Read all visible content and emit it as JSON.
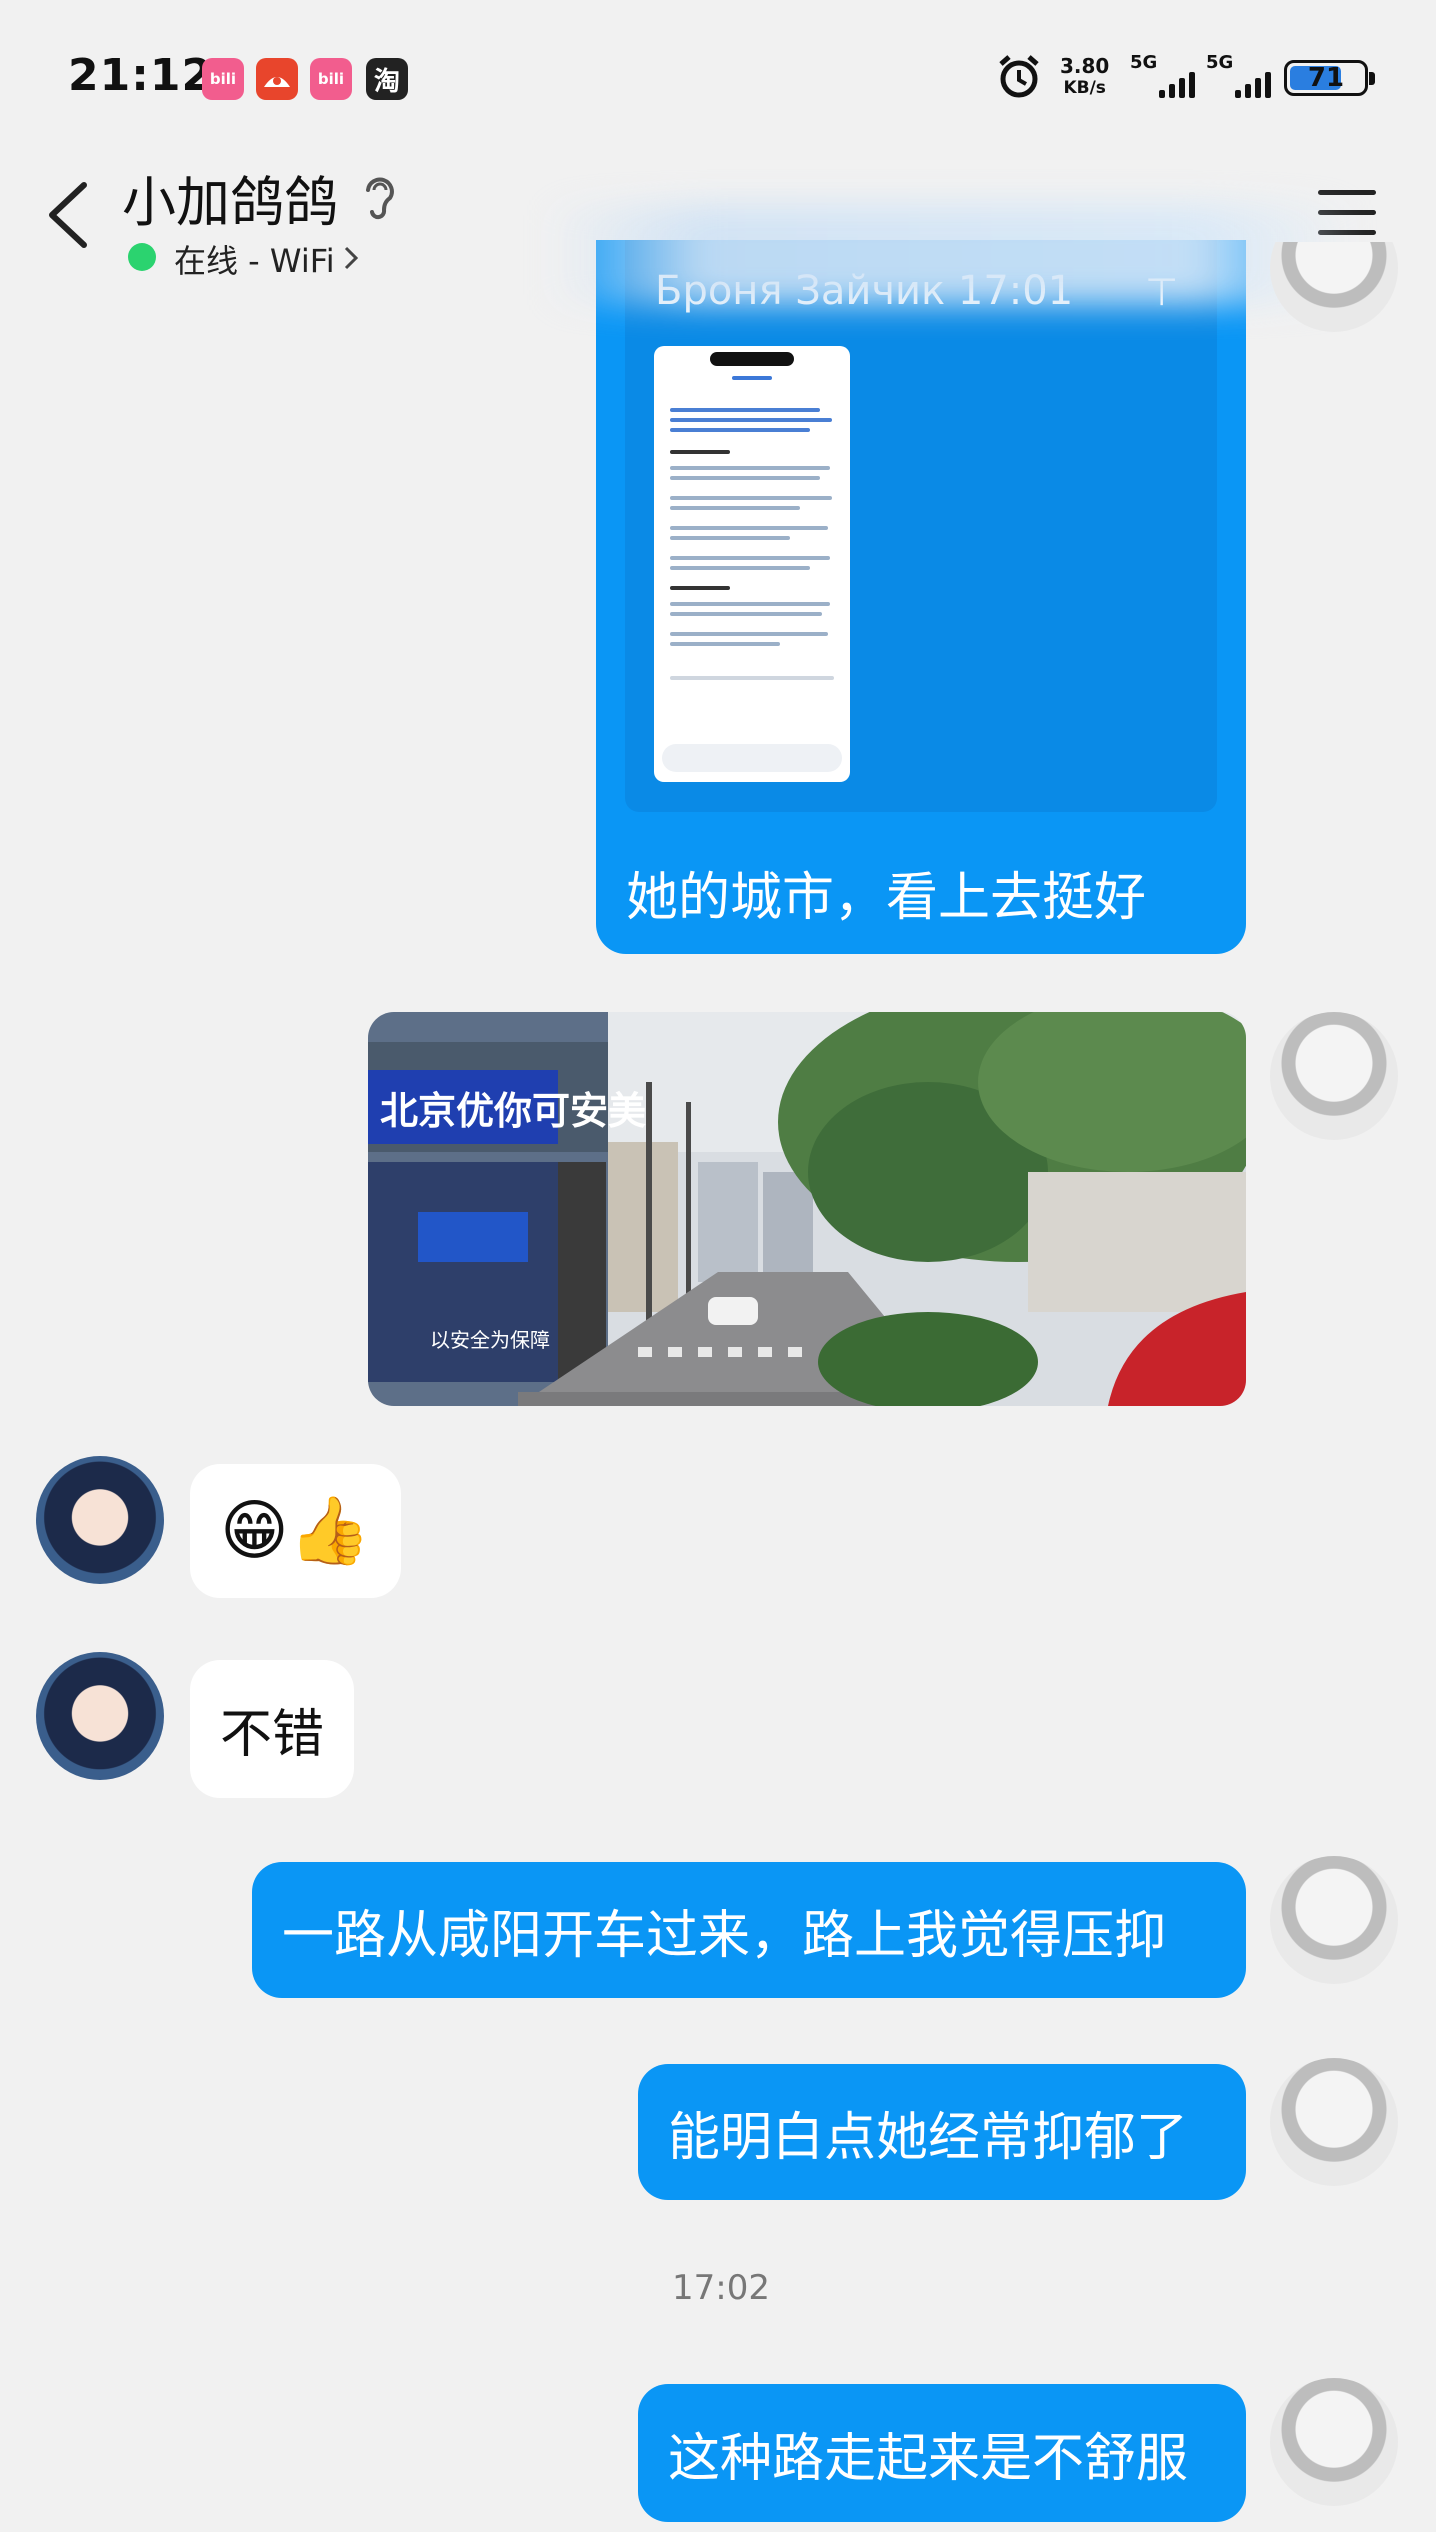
{
  "status_bar": {
    "time": "21:12",
    "app_icons": [
      {
        "name": "bilibili-icon",
        "label": "bili",
        "color": "#f25d8e"
      },
      {
        "name": "red-app-icon",
        "label": "",
        "color": "#e8452c"
      },
      {
        "name": "bilibili-icon-2",
        "label": "bili",
        "color": "#f25d8e"
      },
      {
        "name": "taobao-icon",
        "label": "淘",
        "color": "#222222"
      }
    ],
    "net_speed_value": "3.80",
    "net_speed_unit": "KB/s",
    "sim1_label": "5G",
    "sim2_label": "5G",
    "battery_percent": "71",
    "battery_level": 0.71
  },
  "header": {
    "contact_name": "小加鸽鸽",
    "status": "在线 - WiFi",
    "status_color": "#2bd36f"
  },
  "quoted_message": {
    "sender_time": "Броня Зайчик 17:01",
    "caption": "她的城市，看上去挺好"
  },
  "messages": [
    {
      "side": "left",
      "type": "emoji",
      "text": "😁👍"
    },
    {
      "side": "left",
      "type": "text",
      "text": "不错"
    },
    {
      "side": "right",
      "type": "text",
      "text": "一路从咸阳开车过来，路上我觉得压抑"
    },
    {
      "side": "right",
      "type": "text",
      "text": "能明白点她经常抑郁了"
    },
    {
      "side": "right",
      "type": "text",
      "text": "这种路走起来是不舒服"
    }
  ],
  "timestamp": "17:02",
  "photo_sign": {
    "line1": "北京优你可安美",
    "line2": "以安全为保障"
  },
  "colors": {
    "accent_blue": "#0a96f5",
    "background": "#f1f1f1"
  }
}
